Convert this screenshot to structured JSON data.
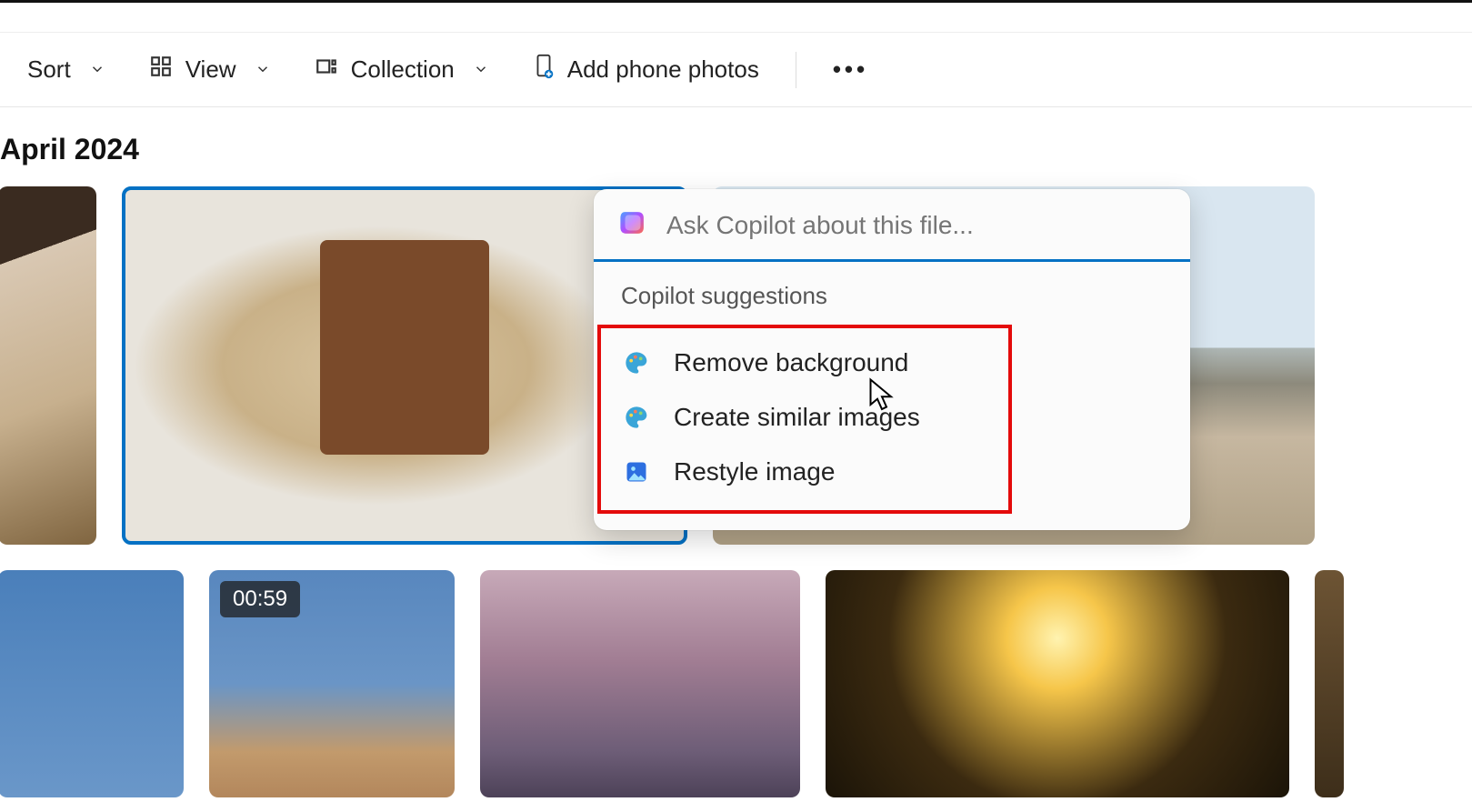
{
  "toolbar": {
    "sort_label": "Sort",
    "view_label": "View",
    "collection_label": "Collection",
    "add_phone_label": "Add phone photos",
    "more_label": "•••"
  },
  "month": "April 2024",
  "video_badge": "00:59",
  "copilot": {
    "placeholder": "Ask Copilot about this file...",
    "section_title": "Copilot suggestions",
    "suggestions": [
      {
        "label": "Remove background",
        "icon": "palette-icon"
      },
      {
        "label": "Create similar images",
        "icon": "palette-icon"
      },
      {
        "label": "Restyle image",
        "icon": "image-icon"
      }
    ]
  }
}
